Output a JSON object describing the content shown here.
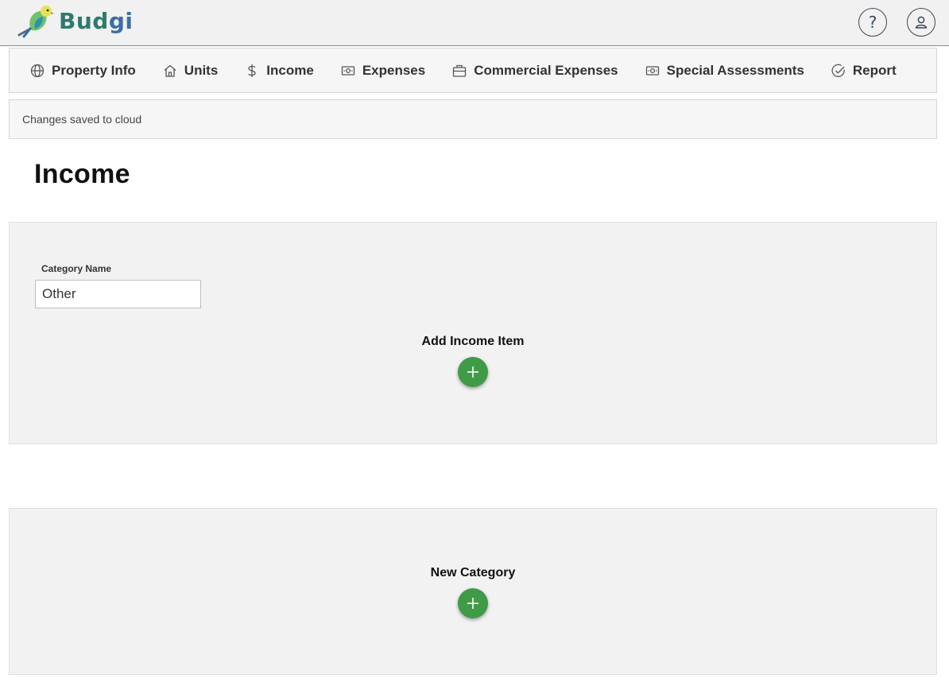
{
  "app": {
    "logo_text_a": "Bud",
    "logo_text_b": "gi"
  },
  "header": {
    "help_icon": "question-icon",
    "user_icon": "user-icon"
  },
  "tabs": [
    {
      "label": "Property Info",
      "icon": "globe-icon"
    },
    {
      "label": "Units",
      "icon": "home-icon"
    },
    {
      "label": "Income",
      "icon": "dollar-icon"
    },
    {
      "label": "Expenses",
      "icon": "cash-icon"
    },
    {
      "label": "Commercial Expenses",
      "icon": "briefcase-icon"
    },
    {
      "label": "Special Assessments",
      "icon": "cash-icon"
    },
    {
      "label": "Report",
      "icon": "check-circle-icon"
    }
  ],
  "status": {
    "text": "Changes saved to cloud"
  },
  "page": {
    "title": "Income"
  },
  "category": {
    "label": "Category Name",
    "value": "Other",
    "add_item_label": "Add Income Item"
  },
  "new_category": {
    "label": "New Category"
  },
  "colors": {
    "accent_green": "#3f9b46",
    "panel_bg": "#f2f2f2",
    "brand_teal": "#2f7a6e"
  }
}
